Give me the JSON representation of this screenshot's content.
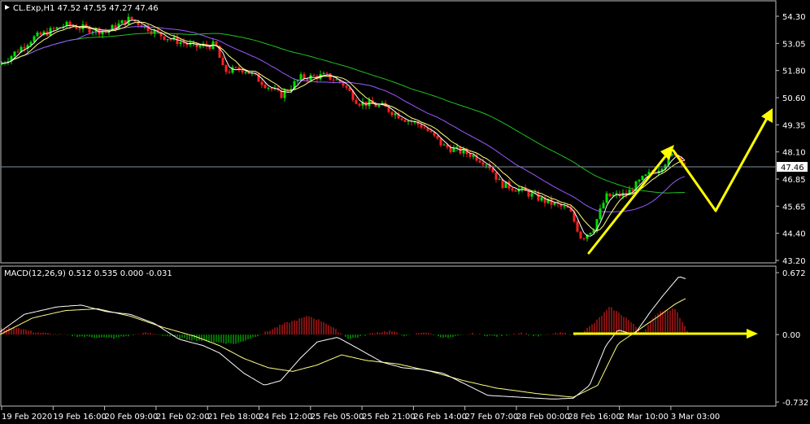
{
  "main_panel": {
    "symbol_info": "CL.Exp,H1  47.52 47.55 47.27 47.46",
    "current_price_label": "47.46",
    "price_ticks": [
      "54.30",
      "53.05",
      "51.80",
      "50.60",
      "49.35",
      "48.10",
      "46.85",
      "45.65",
      "44.40",
      "43.20"
    ]
  },
  "macd_panel": {
    "label": "MACD(12,26,9) 0.512 0.535 0.000 -0.031",
    "ticks": [
      "0.672",
      "0.00",
      "-0.732"
    ]
  },
  "time_axis": [
    "19 Feb 2020",
    "19 Feb 16:00",
    "20 Feb 09:00",
    "21 Feb 02:00",
    "21 Feb 18:00",
    "24 Feb 12:00",
    "25 Feb 05:00",
    "25 Feb 21:00",
    "26 Feb 14:00",
    "27 Feb 07:00",
    "28 Feb 00:00",
    "28 Feb 16:00",
    "2 Mar 10:00",
    "3 Mar 03:00"
  ],
  "colors": {
    "bull": "#00e000",
    "bear": "#ff2020",
    "ma_fast": "#ffffff",
    "ma_mid": "#ffff80",
    "ma_slow": "#9b59ff",
    "ma_long": "#20c020",
    "annotation": "#ffff00",
    "grid": "#c0c0c0"
  },
  "chart_data": {
    "type": "candlestick",
    "price_range": [
      43.2,
      54.3
    ],
    "price_path": [
      [
        0,
        52.1
      ],
      [
        40,
        53.3
      ],
      [
        80,
        53.9
      ],
      [
        130,
        53.6
      ],
      [
        160,
        54.2
      ],
      [
        200,
        53.4
      ],
      [
        240,
        52.9
      ],
      [
        265,
        53.0
      ],
      [
        275,
        51.8
      ],
      [
        300,
        51.9
      ],
      [
        330,
        51.1
      ],
      [
        345,
        50.7
      ],
      [
        370,
        51.5
      ],
      [
        400,
        51.6
      ],
      [
        420,
        51.3
      ],
      [
        440,
        50.4
      ],
      [
        470,
        50.2
      ],
      [
        500,
        49.6
      ],
      [
        520,
        49.3
      ],
      [
        545,
        48.4
      ],
      [
        580,
        48.0
      ],
      [
        600,
        47.6
      ],
      [
        615,
        46.7
      ],
      [
        640,
        46.4
      ],
      [
        670,
        45.9
      ],
      [
        700,
        45.5
      ],
      [
        715,
        44.2
      ],
      [
        730,
        44.7
      ],
      [
        745,
        46.1
      ],
      [
        770,
        46.2
      ],
      [
        790,
        46.9
      ],
      [
        810,
        47.4
      ],
      [
        830,
        48.1
      ],
      [
        845,
        47.5
      ]
    ],
    "macd_range": [
      -0.732,
      0.672
    ],
    "histogram_path": [
      [
        0,
        0.06
      ],
      [
        20,
        0.08
      ],
      [
        40,
        0.03
      ],
      [
        70,
        0.0
      ],
      [
        100,
        -0.02
      ],
      [
        140,
        -0.04
      ],
      [
        180,
        0.02
      ],
      [
        230,
        -0.05
      ],
      [
        260,
        -0.08
      ],
      [
        290,
        -0.1
      ],
      [
        320,
        0.0
      ],
      [
        350,
        0.12
      ],
      [
        380,
        0.2
      ],
      [
        400,
        0.13
      ],
      [
        430,
        -0.05
      ],
      [
        460,
        0.02
      ],
      [
        480,
        0.04
      ],
      [
        500,
        -0.02
      ],
      [
        520,
        0.03
      ],
      [
        550,
        -0.04
      ],
      [
        580,
        0.01
      ],
      [
        610,
        -0.02
      ],
      [
        640,
        0.02
      ],
      [
        660,
        -0.02
      ],
      [
        690,
        0.02
      ],
      [
        710,
        -0.01
      ],
      [
        730,
        0.12
      ],
      [
        750,
        0.3
      ],
      [
        770,
        0.18
      ],
      [
        790,
        0.02
      ],
      [
        810,
        0.25
      ],
      [
        830,
        0.28
      ],
      [
        845,
        0.05
      ]
    ],
    "macd_path": [
      [
        0,
        0.03
      ],
      [
        30,
        0.22
      ],
      [
        70,
        0.3
      ],
      [
        100,
        0.32
      ],
      [
        130,
        0.25
      ],
      [
        160,
        0.22
      ],
      [
        190,
        0.12
      ],
      [
        220,
        -0.05
      ],
      [
        250,
        -0.12
      ],
      [
        270,
        -0.2
      ],
      [
        300,
        -0.42
      ],
      [
        325,
        -0.55
      ],
      [
        345,
        -0.5
      ],
      [
        370,
        -0.25
      ],
      [
        390,
        -0.08
      ],
      [
        415,
        -0.03
      ],
      [
        440,
        -0.15
      ],
      [
        470,
        -0.3
      ],
      [
        495,
        -0.36
      ],
      [
        520,
        -0.38
      ],
      [
        545,
        -0.42
      ],
      [
        575,
        -0.55
      ],
      [
        600,
        -0.66
      ],
      [
        640,
        -0.68
      ],
      [
        680,
        -0.7
      ],
      [
        705,
        -0.69
      ],
      [
        725,
        -0.55
      ],
      [
        745,
        -0.12
      ],
      [
        760,
        0.05
      ],
      [
        780,
        0.0
      ],
      [
        800,
        0.25
      ],
      [
        815,
        0.42
      ],
      [
        835,
        0.63
      ],
      [
        845,
        0.6
      ]
    ],
    "signal_path": [
      [
        0,
        0.0
      ],
      [
        40,
        0.18
      ],
      [
        80,
        0.26
      ],
      [
        120,
        0.28
      ],
      [
        160,
        0.2
      ],
      [
        200,
        0.08
      ],
      [
        240,
        -0.02
      ],
      [
        270,
        -0.12
      ],
      [
        300,
        -0.26
      ],
      [
        330,
        -0.36
      ],
      [
        360,
        -0.4
      ],
      [
        390,
        -0.33
      ],
      [
        420,
        -0.22
      ],
      [
        450,
        -0.28
      ],
      [
        490,
        -0.32
      ],
      [
        530,
        -0.4
      ],
      [
        570,
        -0.5
      ],
      [
        610,
        -0.58
      ],
      [
        660,
        -0.64
      ],
      [
        705,
        -0.68
      ],
      [
        735,
        -0.55
      ],
      [
        760,
        -0.1
      ],
      [
        785,
        0.05
      ],
      [
        810,
        0.2
      ],
      [
        830,
        0.33
      ],
      [
        845,
        0.4
      ]
    ]
  }
}
